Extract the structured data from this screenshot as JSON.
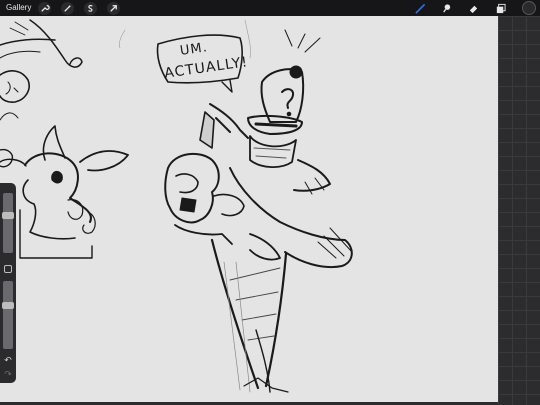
{
  "topbar": {
    "gallery_label": "Gallery",
    "left_tools": [
      {
        "name": "adjustments-wrench-icon"
      },
      {
        "name": "selection-magic-wand-icon"
      },
      {
        "name": "selection-s-icon"
      },
      {
        "name": "transform-arrow-icon"
      }
    ],
    "right_tools": [
      {
        "name": "brush-icon",
        "active": true
      },
      {
        "name": "smudge-icon"
      },
      {
        "name": "eraser-icon"
      },
      {
        "name": "layers-icon"
      },
      {
        "name": "color-swatch"
      }
    ],
    "accent_color": "#2f6fe0"
  },
  "canvas": {
    "speech_bubble_text_1": "UM.",
    "speech_bubble_text_2": "ACTUALLY!",
    "background_color": "#e4e4e4"
  },
  "sidebar": {
    "size_slider_level": 0.35,
    "opacity_slider_level": 0.35,
    "undo_glyph": "↶",
    "redo_glyph": "↷"
  }
}
